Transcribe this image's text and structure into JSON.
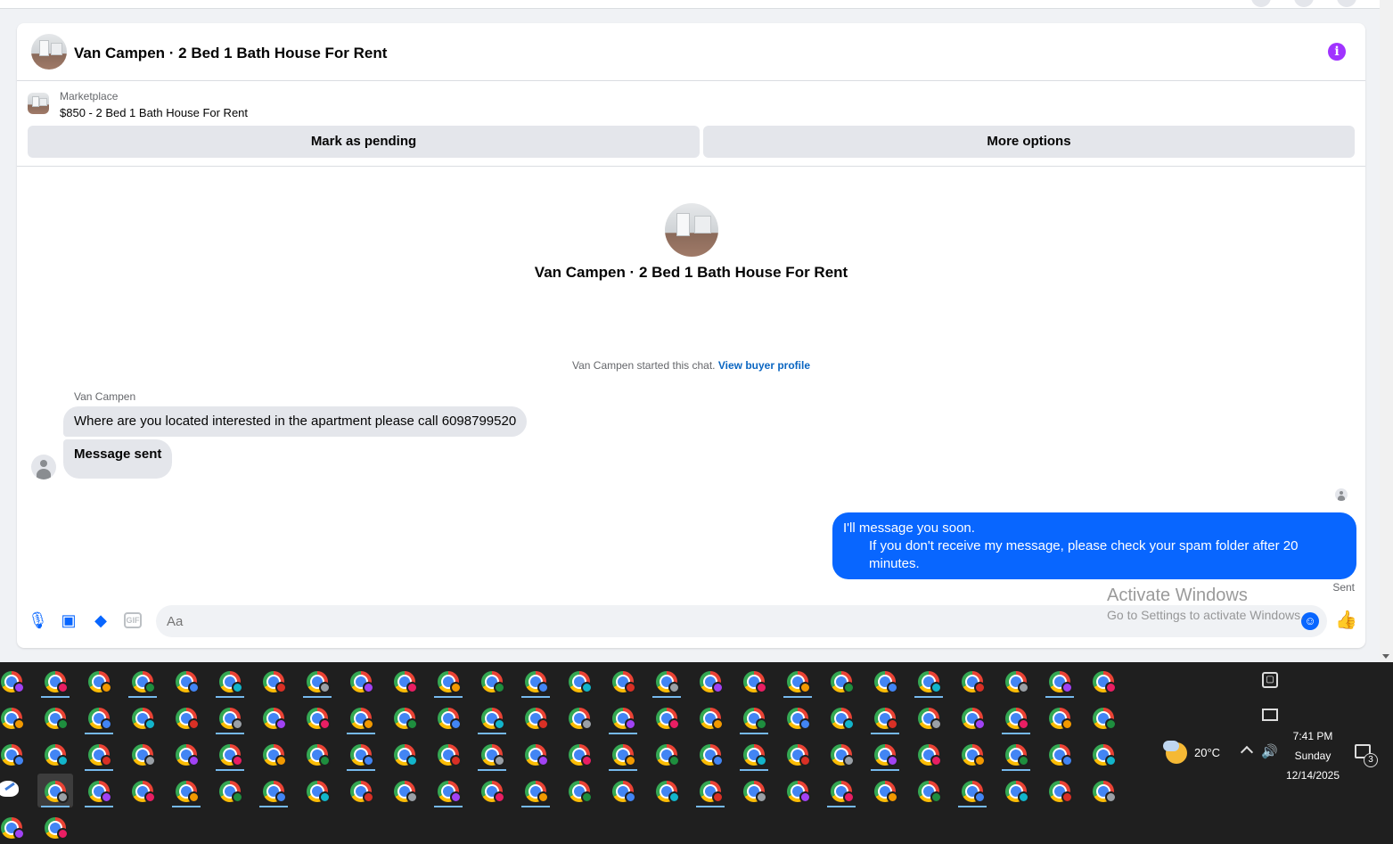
{
  "conversation": {
    "title": "Van Campen · 2 Bed 1 Bath House For Rent",
    "info_icon": "info-icon"
  },
  "listing": {
    "kicker": "Marketplace",
    "title": "$850 - 2 Bed 1 Bath House For Rent",
    "mark_pending_label": "Mark as pending",
    "more_options_label": "More options"
  },
  "chat": {
    "center_title": "Van Campen · 2 Bed 1 Bath House For Rent",
    "started_text": "Van Campen started this chat.",
    "view_profile_link": "View buyer profile",
    "sender_name": "Van Campen",
    "incoming": [
      "Where are you located interested in the apartment please call 6098799520",
      "Message sent"
    ],
    "outgoing": {
      "line1": "I'll message you soon.",
      "line2": "If you don't receive my message, please check your spam folder after 20 minutes."
    },
    "status": "Sent"
  },
  "composer": {
    "placeholder": "Aa",
    "gif_label": "GIF"
  },
  "watermark": {
    "line1": "Activate Windows",
    "line2": "Go to Settings to activate Windows."
  },
  "taskbar": {
    "temperature": "20°C",
    "time": "7:41 PM",
    "day": "Sunday",
    "date": "12/14/2025",
    "notification_count": "3",
    "profile_colors": [
      "#a142f4",
      "#e91e63",
      "#f29900",
      "#1e8e3e",
      "#4285f4",
      "#12b5cb",
      "#d93025",
      "#9aa0a6"
    ]
  },
  "colors": {
    "accent": "#0866ff",
    "info": "#a033ff",
    "link": "#0a66c2"
  }
}
